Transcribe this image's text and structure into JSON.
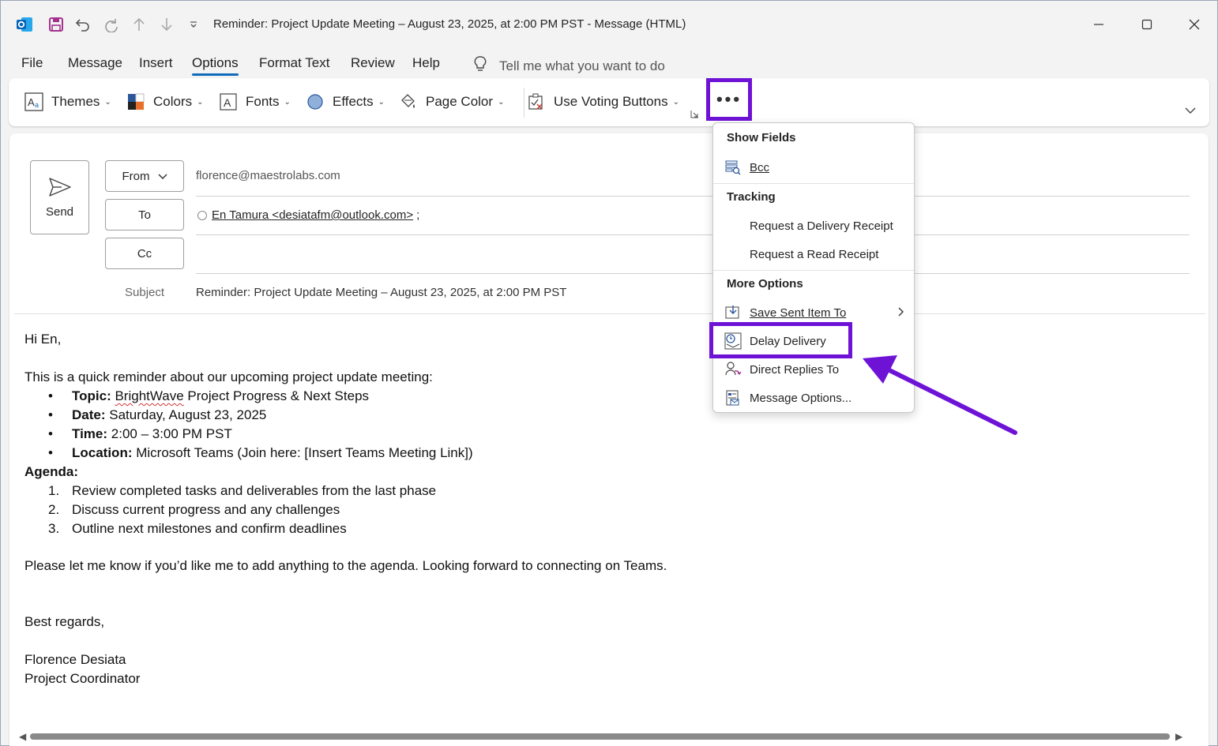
{
  "title": "Reminder: Project Update Meeting – August 23, 2025, at 2:00 PM PST  -  Message (HTML)",
  "tabs": [
    "File",
    "Message",
    "Insert",
    "Options",
    "Format Text",
    "Review",
    "Help"
  ],
  "active_tab": "Options",
  "tell_me": "Tell me what you want to do",
  "ribbon": {
    "themes": "Themes",
    "colors": "Colors",
    "fonts": "Fonts",
    "effects": "Effects",
    "page_color": "Page Color",
    "voting": "Use Voting Buttons",
    "more": "•••"
  },
  "compose": {
    "send": "Send",
    "from_label": "From",
    "to_label": "To",
    "cc_label": "Cc",
    "from_value": "florence@maestrolabs.com",
    "to_value": "En Tamura <desiatafm@outlook.com>",
    "to_suffix": ";",
    "subject_label": "Subject",
    "subject_value": "Reminder: Project Update Meeting – August 23, 2025, at 2:00 PM PST"
  },
  "body": {
    "greeting": "Hi En,",
    "intro": "This is a quick reminder about our upcoming project update meeting:",
    "topic_label": "Topic:",
    "topic_brand": "BrightWave",
    "topic_rest": " Project Progress & Next Steps",
    "date_label": "Date:",
    "date_value": " Saturday, August 23, 2025",
    "time_label": "Time:",
    "time_value": " 2:00 – 3:00 PM PST",
    "location_label": "Location:",
    "location_value": " Microsoft Teams (Join here: [Insert Teams Meeting Link])",
    "agenda_label": "Agenda:",
    "agenda": [
      {
        "n": "1.",
        "text": "Review completed tasks and deliverables from the last phase"
      },
      {
        "n": "2.",
        "text": "Discuss current progress and any challenges"
      },
      {
        "n": "3.",
        "text": "Outline next milestones and confirm deadlines"
      }
    ],
    "closing_line": "Please let me know if you’d like me to add anything to the agenda. Looking forward to connecting on Teams.",
    "regards": "Best regards,",
    "name": "Florence Desiata",
    "role": "Project Coordinator"
  },
  "dropdown": {
    "show_fields": "Show Fields",
    "bcc": "Bcc",
    "tracking": "Tracking",
    "delivery_receipt": "Request a Delivery Receipt",
    "read_receipt": "Request a Read Receipt",
    "more_options": "More Options",
    "save_sent": "Save Sent Item To",
    "delay_delivery": "Delay Delivery",
    "direct_replies": "Direct Replies To",
    "message_options": "Message Options..."
  },
  "colors": {
    "accent": "#0f6cbd",
    "highlight": "#6e13d6"
  }
}
